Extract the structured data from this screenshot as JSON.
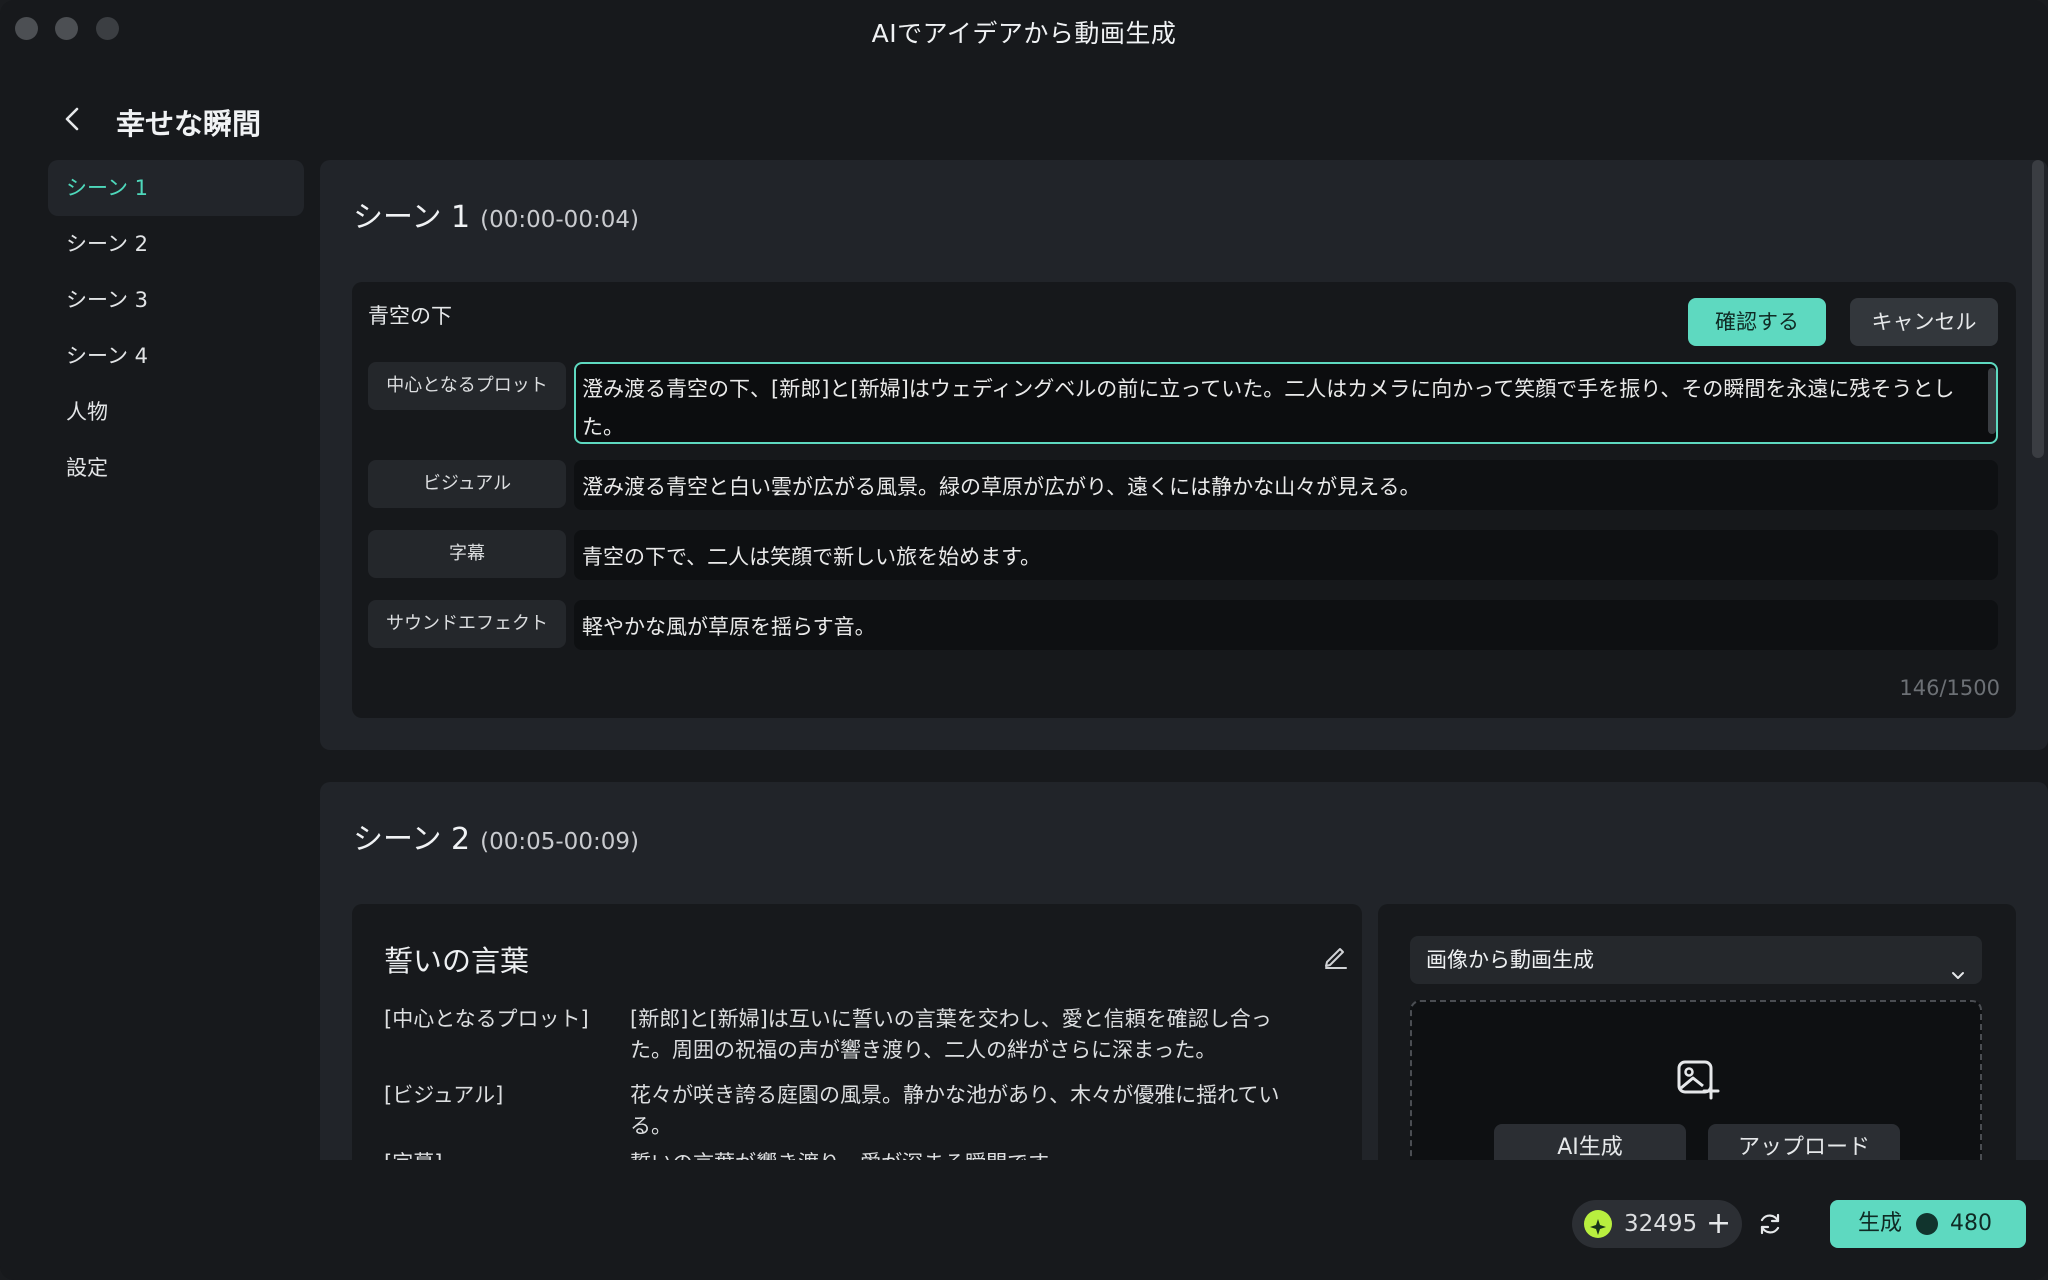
{
  "window": {
    "title": "AIでアイデアから動画生成"
  },
  "header": {
    "page_title": "幸せな瞬間"
  },
  "sidebar": {
    "items": [
      {
        "label": "シーン 1",
        "active": true
      },
      {
        "label": "シーン 2"
      },
      {
        "label": "シーン 3"
      },
      {
        "label": "シーン 4"
      },
      {
        "label": "人物"
      },
      {
        "label": "設定"
      }
    ]
  },
  "scene1": {
    "title": "シーン 1",
    "time": "(00:00-00:04)",
    "edit": {
      "title": "青空の下",
      "confirm_label": "確認する",
      "cancel_label": "キャンセル",
      "rows": [
        {
          "label": "中心となるプロット",
          "value": "澄み渡る青空の下、[新郎]と[新婦]はウェディングベルの前に立っていた。二人はカメラに向かって笑顔で手を振り、その瞬間を永遠に残そうとした。"
        },
        {
          "label": "ビジュアル",
          "value": "澄み渡る青空と白い雲が広がる風景。緑の草原が広がり、遠くには静かな山々が見える。"
        },
        {
          "label": "字幕",
          "value": "青空の下で、二人は笑顔で新しい旅を始めます。"
        },
        {
          "label": "サウンドエフェクト",
          "value": "軽やかな風が草原を揺らす音。"
        }
      ],
      "counter": "146/1500"
    }
  },
  "scene2": {
    "title": "シーン 2",
    "time": "(00:05-00:09)",
    "card_title": "誓いの言葉",
    "fields": [
      {
        "key": "[中心となるプロット]",
        "value": "[新郎]と[新婦]は互いに誓いの言葉を交わし、愛と信頼を確認し合った。周囲の祝福の声が響き渡り、二人の絆がさらに深まった。"
      },
      {
        "key": "[ビジュアル]",
        "value": "花々が咲き誇る庭園の風景。静かな池があり、木々が優雅に揺れている。"
      },
      {
        "key": "[字幕]",
        "value": "誓いの言葉が響き渡り、愛が深まる瞬間です。"
      }
    ],
    "mode_select": "画像から動画生成",
    "ai_button": "AI生成",
    "upload_button": "アップロード"
  },
  "footer": {
    "credits": "32495",
    "generate_label": "生成",
    "generate_cost": "480"
  },
  "colors": {
    "accent": "#5ed9c0",
    "credit_coin": "#b8ef3f"
  }
}
